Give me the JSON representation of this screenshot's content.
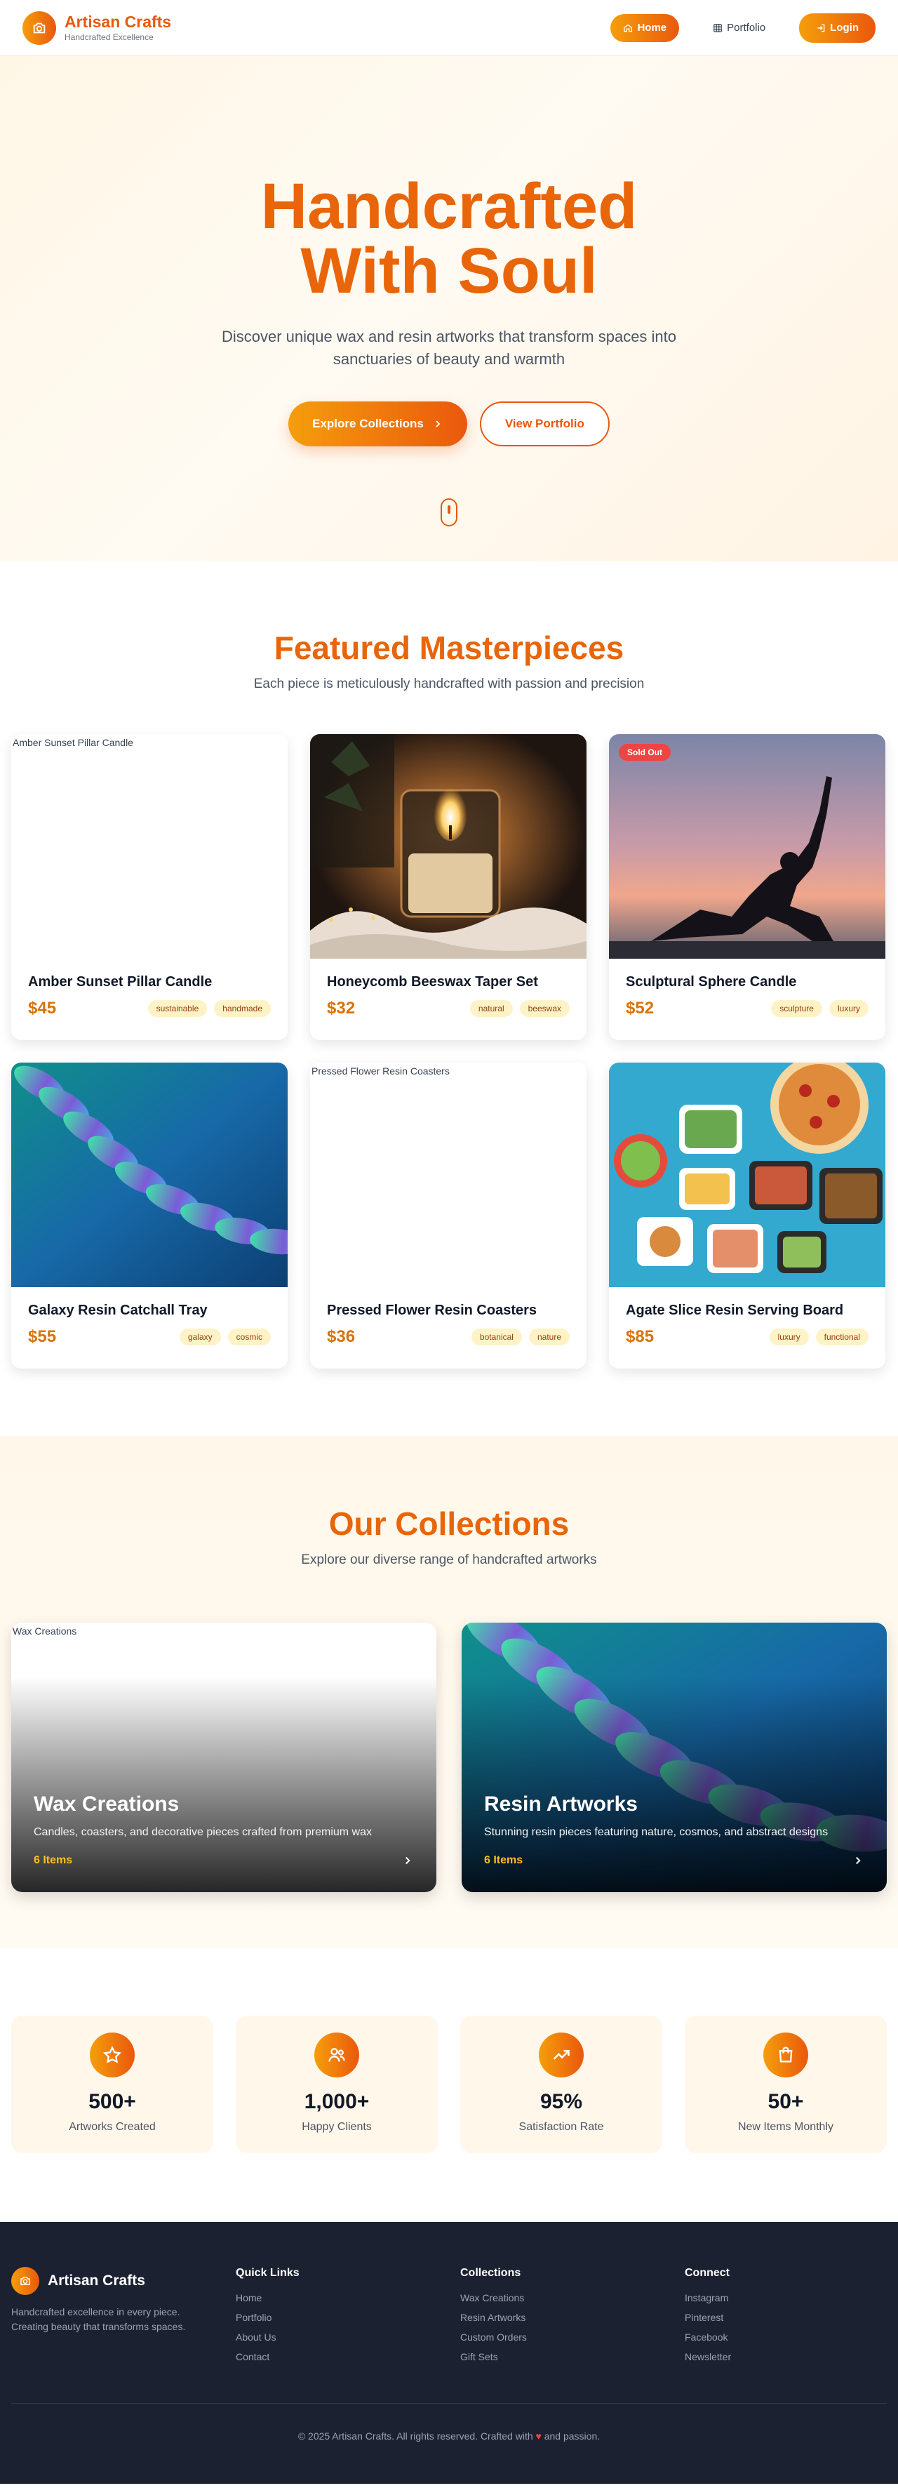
{
  "nav": {
    "brand_name": "Artisan Crafts",
    "brand_tag": "Handcrafted Excellence",
    "home": "Home",
    "portfolio": "Portfolio",
    "login": "Login"
  },
  "hero": {
    "title_line1": "Handcrafted",
    "title_line2": "With Soul",
    "subtitle": "Discover unique wax and resin artworks that transform spaces into sanctuaries of beauty and warmth",
    "primary_btn": "Explore Collections",
    "secondary_btn": "View Portfolio"
  },
  "featured": {
    "title": "Featured Masterpieces",
    "subtitle": "Each piece is meticulously handcrafted with passion and precision",
    "items": [
      {
        "title": "Amber Sunset Pillar Candle",
        "price": "$45",
        "tags": [
          "sustainable",
          "handmade"
        ],
        "alt": "Amber Sunset Pillar Candle",
        "image": "broken"
      },
      {
        "title": "Honeycomb Beeswax Taper Set",
        "price": "$32",
        "tags": [
          "natural",
          "beeswax"
        ],
        "image": "candle"
      },
      {
        "title": "Sculptural Sphere Candle",
        "price": "$52",
        "tags": [
          "sculpture",
          "luxury"
        ],
        "image": "yoga",
        "badge": "Sold Out"
      },
      {
        "title": "Galaxy Resin Catchall Tray",
        "price": "$55",
        "tags": [
          "galaxy",
          "cosmic"
        ],
        "image": "wave"
      },
      {
        "title": "Pressed Flower Resin Coasters",
        "price": "$36",
        "tags": [
          "botanical",
          "nature"
        ],
        "alt": "Pressed Flower Resin Coasters",
        "image": "broken"
      },
      {
        "title": "Agate Slice Resin Serving Board",
        "price": "$85",
        "tags": [
          "luxury",
          "functional"
        ],
        "image": "food"
      }
    ]
  },
  "collections": {
    "title": "Our Collections",
    "subtitle": "Explore our diverse range of handcrafted artworks",
    "items": [
      {
        "title": "Wax Creations",
        "desc": "Candles, coasters, and decorative pieces crafted from premium wax",
        "count": "6 Items",
        "alt": "Wax Creations"
      },
      {
        "title": "Resin Artworks",
        "desc": "Stunning resin pieces featuring nature, cosmos, and abstract designs",
        "count": "6 Items"
      }
    ]
  },
  "stats": [
    {
      "value": "500+",
      "label": "Artworks Created",
      "icon": "star-icon"
    },
    {
      "value": "1,000+",
      "label": "Happy Clients",
      "icon": "users-icon"
    },
    {
      "value": "95%",
      "label": "Satisfaction Rate",
      "icon": "trending-up-icon"
    },
    {
      "value": "50+",
      "label": "New Items Monthly",
      "icon": "shopping-bag-icon"
    }
  ],
  "footer": {
    "brand_name": "Artisan Crafts",
    "desc": "Handcrafted excellence in every piece. Creating beauty that transforms spaces.",
    "quick_title": "Quick Links",
    "quick": [
      "Home",
      "Portfolio",
      "About Us",
      "Contact"
    ],
    "coll_title": "Collections",
    "coll": [
      "Wax Creations",
      "Resin Artworks",
      "Custom Orders",
      "Gift Sets"
    ],
    "connect_title": "Connect",
    "connect": [
      "Instagram",
      "Pinterest",
      "Facebook",
      "Newsletter"
    ],
    "copy_before": "© 2025 Artisan Crafts. All rights reserved. Crafted with",
    "copy_after": "and passion."
  },
  "colors": {
    "accent": "#ea580c",
    "accent_light": "#f59e0b",
    "footer_bg": "#1b2130"
  }
}
